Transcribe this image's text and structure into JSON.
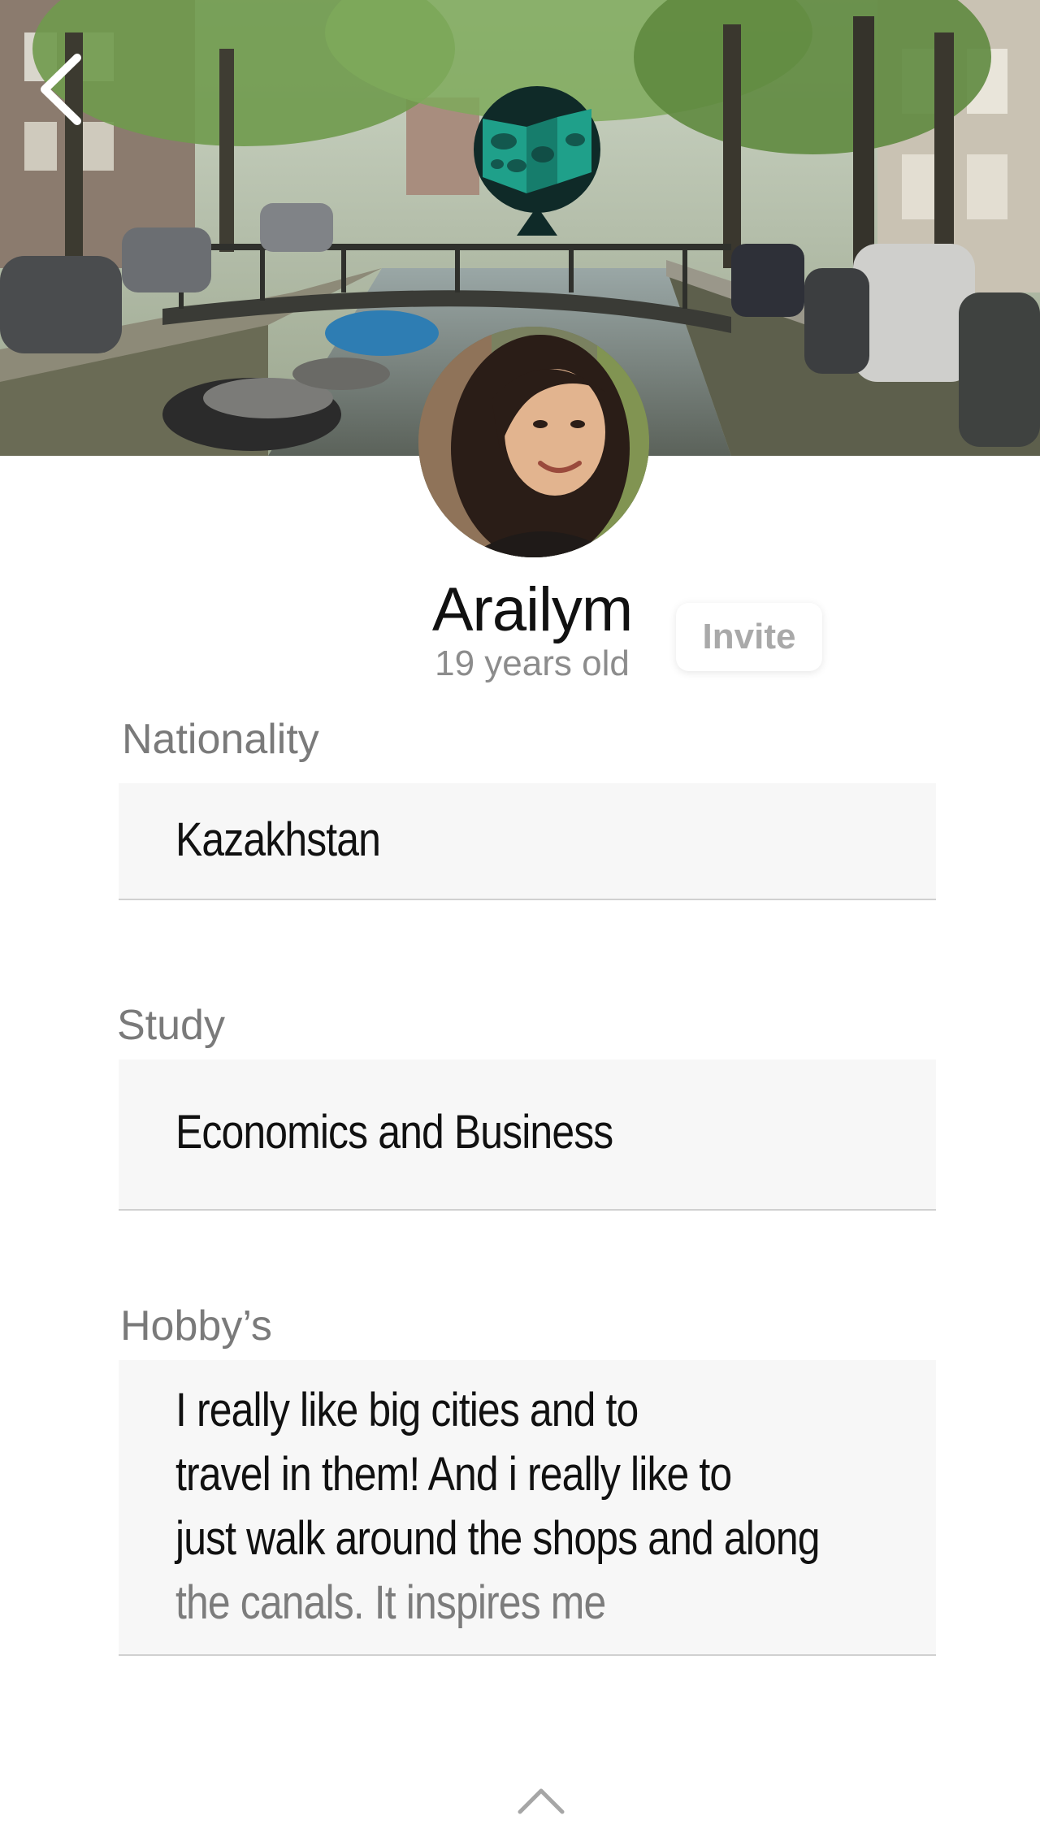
{
  "header": {
    "back_icon": "chevron-left-icon",
    "logo_icon": "map-pin-logo-icon",
    "photo_description_icon": "canal-photo"
  },
  "profile": {
    "avatar_icon": "user-avatar",
    "name": "Arailym",
    "age": "19 years old",
    "invite_label": "Invite"
  },
  "fields": {
    "nationality": {
      "label": "Nationality",
      "value": "Kazakhstan"
    },
    "study": {
      "label": "Study",
      "value": "Economics and Business"
    },
    "hobbies": {
      "label": "Hobby’s",
      "lines": [
        "I really like big cities and to",
        "travel in them! And i really like to",
        "just walk around the shops and along",
        "the canals. It inspires me"
      ]
    }
  },
  "footer": {
    "scroll_icon": "chevron-up-icon"
  },
  "colors": {
    "field_bg": "#f7f7f7",
    "label_gray": "#7a7a7a",
    "logo_teal": "#1fa08a",
    "logo_dark": "#0f2a28"
  }
}
